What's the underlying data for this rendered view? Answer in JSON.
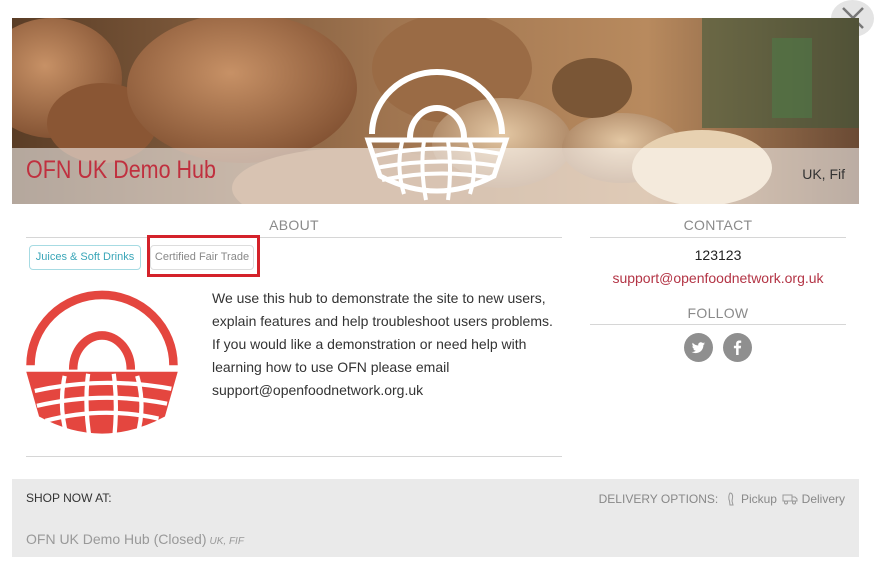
{
  "hero": {
    "hub_name": "OFN UK Demo Hub",
    "location": "UK, Fif"
  },
  "about": {
    "title": "ABOUT",
    "tags": [
      "Juices & Soft Drinks",
      "Certified Fair Trade"
    ],
    "description": "We use this hub to demonstrate the site to new users, explain features and help troubleshoot users problems. If you would like a demonstration or need help with learning how to use OFN please email support@openfoodnetwork.org.uk"
  },
  "contact": {
    "title": "CONTACT",
    "phone": "123123",
    "email": "support@openfoodnetwork.org.uk"
  },
  "follow": {
    "title": "FOLLOW",
    "icons": [
      "twitter-icon",
      "facebook-icon"
    ]
  },
  "shop": {
    "label": "SHOP NOW AT:",
    "delivery_label": "DELIVERY OPTIONS:",
    "pickup": "Pickup",
    "delivery": "Delivery",
    "link_name": "OFN UK Demo Hub (Closed)",
    "link_location": "UK, FIF"
  },
  "colors": {
    "accent_red": "#c0303f",
    "logo_red": "#e4463f",
    "tag_teal": "#3aa6b8",
    "highlight": "#d4222a"
  }
}
